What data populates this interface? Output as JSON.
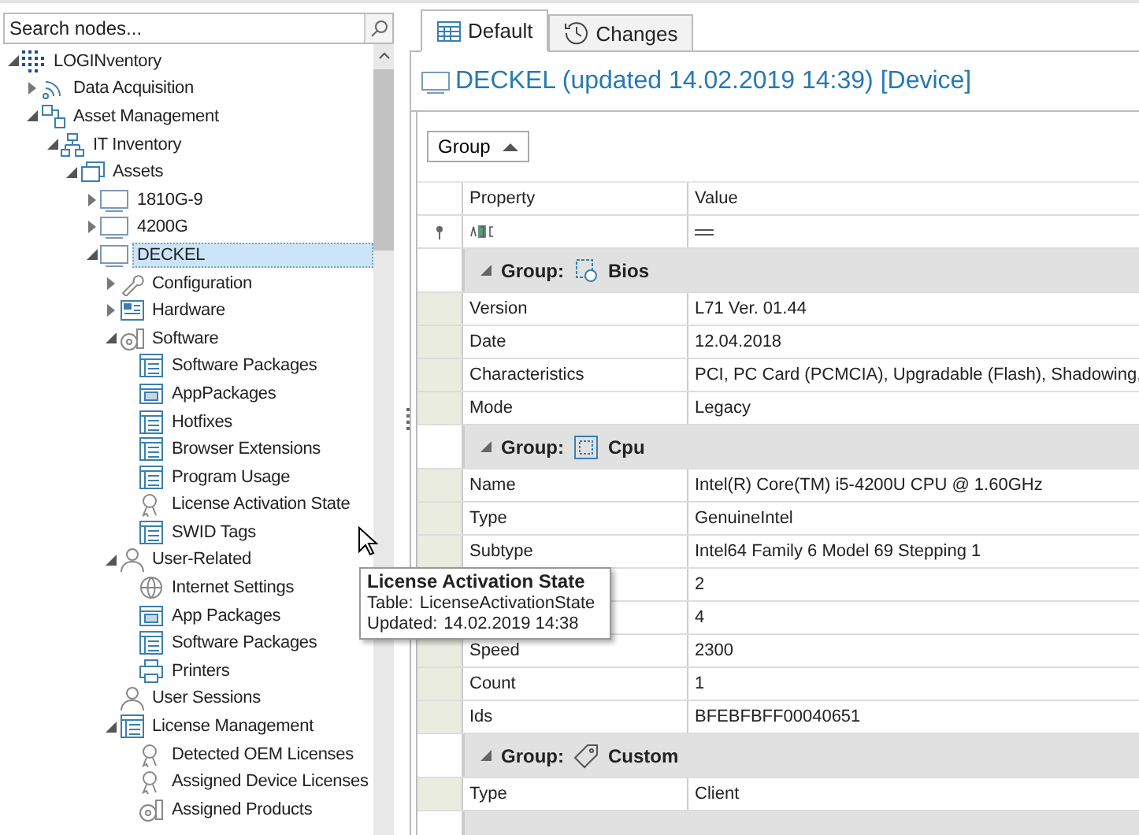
{
  "search": {
    "placeholder": "Search nodes..."
  },
  "tree": [
    {
      "label": "LOGINventory",
      "kind": "logo",
      "expanded": true,
      "selected": false,
      "children": [
        {
          "label": "Data Acquisition",
          "kind": "wifi",
          "expanded": false,
          "selected": false
        },
        {
          "label": "Asset Management",
          "kind": "nodes",
          "expanded": true,
          "selected": false,
          "children": [
            {
              "label": "IT Inventory",
              "kind": "network",
              "expanded": true,
              "selected": false,
              "children": [
                {
                  "label": "Assets",
                  "kind": "assets",
                  "expanded": true,
                  "selected": false,
                  "children": [
                    {
                      "label": "1810G-9",
                      "kind": "monitor",
                      "expanded": false,
                      "selected": false
                    },
                    {
                      "label": "4200G",
                      "kind": "monitor",
                      "expanded": false,
                      "selected": false
                    },
                    {
                      "label": "DECKEL",
                      "kind": "monitor",
                      "expanded": true,
                      "selected": true,
                      "children": [
                        {
                          "label": "Configuration",
                          "kind": "wrench",
                          "expanded": false,
                          "selected": false
                        },
                        {
                          "label": "Hardware",
                          "kind": "hardware",
                          "expanded": false,
                          "selected": false
                        },
                        {
                          "label": "Software",
                          "kind": "software",
                          "expanded": true,
                          "selected": false,
                          "children": [
                            {
                              "label": "Software Packages",
                              "kind": "table",
                              "selected": false
                            },
                            {
                              "label": "AppPackages",
                              "kind": "app",
                              "selected": false
                            },
                            {
                              "label": "Hotfixes",
                              "kind": "table",
                              "selected": false
                            },
                            {
                              "label": "Browser Extensions",
                              "kind": "table",
                              "selected": false
                            },
                            {
                              "label": "Program Usage",
                              "kind": "table",
                              "selected": false
                            },
                            {
                              "label": "License Activation State",
                              "kind": "license",
                              "selected": false
                            },
                            {
                              "label": "SWID Tags",
                              "kind": "table",
                              "selected": false
                            }
                          ]
                        },
                        {
                          "label": "User-Related",
                          "kind": "user",
                          "expanded": true,
                          "selected": false,
                          "children": [
                            {
                              "label": "Internet Settings",
                              "kind": "globe",
                              "selected": false
                            },
                            {
                              "label": "App Packages",
                              "kind": "app",
                              "selected": false
                            },
                            {
                              "label": "Software Packages",
                              "kind": "table",
                              "selected": false
                            },
                            {
                              "label": "Printers",
                              "kind": "printer",
                              "selected": false
                            }
                          ]
                        },
                        {
                          "label": "User Sessions",
                          "kind": "user",
                          "selected": false
                        },
                        {
                          "label": "License Management",
                          "kind": "table",
                          "expanded": true,
                          "selected": false,
                          "children": [
                            {
                              "label": "Detected OEM Licenses",
                              "kind": "license",
                              "selected": false
                            },
                            {
                              "label": "Assigned Device Licenses",
                              "kind": "license",
                              "selected": false
                            },
                            {
                              "label": "Assigned Products",
                              "kind": "software",
                              "selected": false
                            }
                          ]
                        }
                      ]
                    }
                  ]
                }
              ]
            }
          ]
        }
      ]
    }
  ],
  "tabs": [
    {
      "label": "Default",
      "kind": "grid",
      "selected": true
    },
    {
      "label": "Changes",
      "kind": "history",
      "selected": false
    }
  ],
  "title": "DECKEL (updated 14.02.2019 14:39) [Device]",
  "group_button": {
    "label": "Group"
  },
  "columns": [
    "Property",
    "Value"
  ],
  "groups": [
    {
      "prefix": "Group:",
      "name": "Bios",
      "kind": "bios",
      "rows": [
        {
          "property": "Version",
          "value": "L71 Ver. 01.44"
        },
        {
          "property": "Date",
          "value": "12.04.2018"
        },
        {
          "property": "Characteristics",
          "value": "PCI, PC Card (PCMCIA), Upgradable (Flash), Shadowing,"
        },
        {
          "property": "Mode",
          "value": "Legacy"
        }
      ]
    },
    {
      "prefix": "Group:",
      "name": "Cpu",
      "kind": "cpu",
      "rows": [
        {
          "property": "Name",
          "value": "Intel(R) Core(TM) i5-4200U CPU @ 1.60GHz"
        },
        {
          "property": "Type",
          "value": "GenuineIntel"
        },
        {
          "property": "Subtype",
          "value": "Intel64 Family 6 Model 69 Stepping 1"
        },
        {
          "value": "2"
        },
        {
          "value": "4"
        },
        {
          "property": "Speed",
          "value": "2300"
        },
        {
          "property": "Count",
          "value": "1"
        },
        {
          "property": "Ids",
          "value": "BFEBFBFF00040651"
        }
      ]
    },
    {
      "prefix": "Group:",
      "name": "Custom",
      "kind": "tag",
      "rows": [
        {
          "property": "Type",
          "value": "Client"
        }
      ]
    }
  ],
  "tooltip": {
    "title": "License Activation State",
    "lines": [
      {
        "label": "Table:",
        "value": "LicenseActivationState"
      },
      {
        "label": "Updated:",
        "value": "14.02.2019 14:38"
      }
    ]
  }
}
